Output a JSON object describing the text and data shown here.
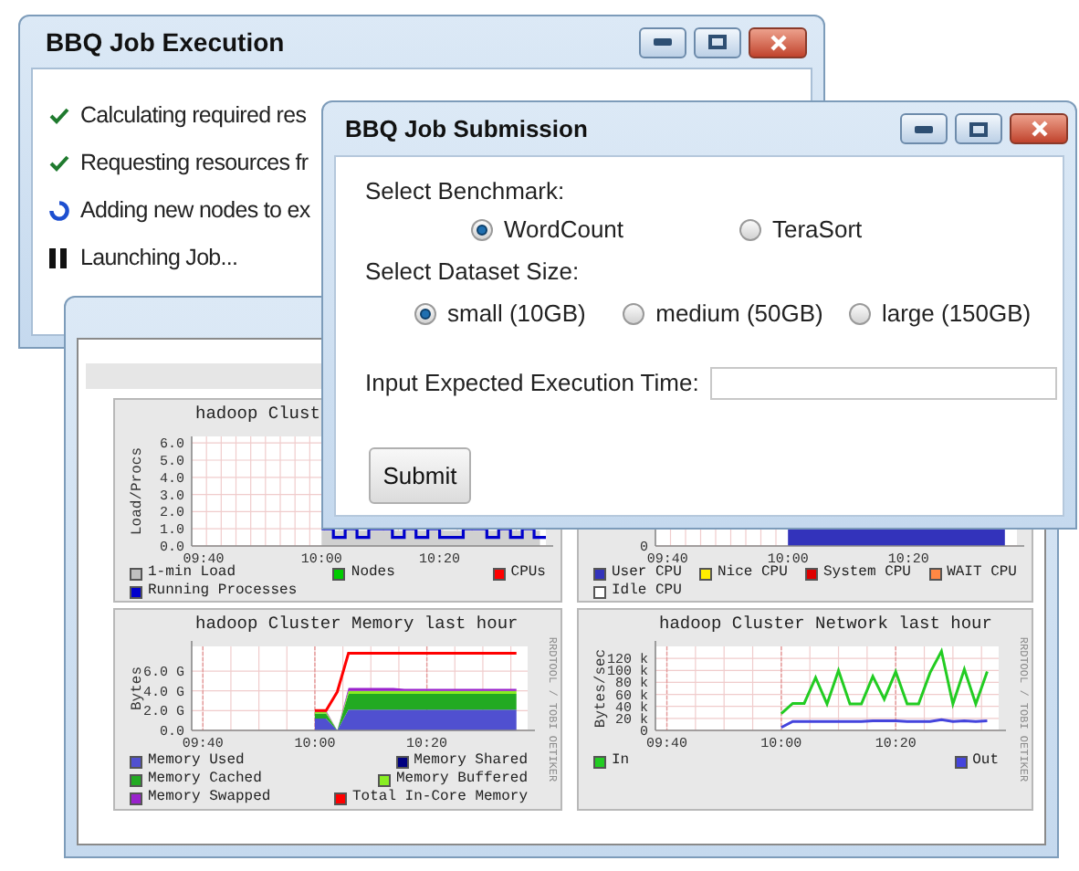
{
  "execution_window": {
    "title": "BBQ Job Execution",
    "steps": [
      {
        "kind": "done",
        "text": "Calculating required res"
      },
      {
        "kind": "done",
        "text": "Requesting resources fr"
      },
      {
        "kind": "running",
        "text": "Adding new nodes to ex"
      },
      {
        "kind": "paused",
        "text": "Launching Job..."
      }
    ]
  },
  "monitor_window": {
    "charts": [
      {
        "kind": "lines",
        "title": "hadoop Clust",
        "ylabel": "Load/Procs",
        "yticks": [
          "6.0",
          "5.0",
          "4.0",
          "3.0",
          "2.0",
          "1.0",
          "0.0"
        ],
        "xticks": [
          "09:40",
          "10:00",
          "10:20"
        ],
        "legend": [
          {
            "label": "1-min Load",
            "color": "#c0c0c0"
          },
          {
            "label": "Nodes",
            "color": "#00cc00"
          },
          {
            "label": "CPUs",
            "color": "#ff0000"
          },
          {
            "label": "Running Processes",
            "color": "#0000cc"
          }
        ]
      },
      {
        "kind": "fill",
        "yticks": [
          "0"
        ],
        "xticks": [
          "09:40",
          "10:00",
          "10:20"
        ],
        "legend": [
          {
            "label": "User CPU",
            "color": "#3333bb"
          },
          {
            "label": "Nice CPU",
            "color": "#ffee00"
          },
          {
            "label": "System CPU",
            "color": "#dd0000"
          },
          {
            "label": "WAIT CPU",
            "color": "#ff8844"
          },
          {
            "label": "Idle CPU",
            "color": "#ffffff"
          }
        ]
      },
      {
        "kind": "chart",
        "credit": "RRDTOOL / TOBI OETIKER",
        "chart_data": {
          "type": "area",
          "stacked": true,
          "grid": true,
          "title": "hadoop Cluster Memory last hour",
          "ylabel": "Bytes",
          "categories": [
            "09:40",
            null,
            null,
            null,
            null,
            null,
            null,
            null,
            null,
            null,
            "10:00",
            null,
            null,
            null,
            null,
            null,
            null,
            null,
            null,
            null,
            "10:20",
            null,
            null,
            null,
            null,
            null,
            null,
            null,
            null
          ],
          "ylim": [
            0,
            8.5
          ],
          "yticks": [
            {
              "value": 0,
              "label": "0.0"
            },
            {
              "value": 2,
              "label": "2.0 G"
            },
            {
              "value": 4,
              "label": "4.0 G"
            },
            {
              "value": 6,
              "label": "6.0 G"
            }
          ],
          "series": [
            {
              "name": "Memory Used",
              "color": "#5050d0",
              "values": [
                null,
                null,
                null,
                null,
                null,
                null,
                null,
                null,
                null,
                null,
                1.2,
                1.2,
                0,
                2.1,
                2.1,
                2.1,
                2.1,
                2.1,
                2.1,
                2.1,
                2.1,
                2.1,
                2.1,
                2.1,
                2.1,
                2.1,
                2.1,
                2.1,
                2.1
              ]
            },
            {
              "name": "Memory Shared",
              "color": "#000080",
              "values": [
                null,
                null,
                null,
                null,
                null,
                null,
                null,
                null,
                null,
                null,
                null,
                null,
                null,
                null,
                null,
                null,
                null,
                null,
                null,
                null,
                null,
                null,
                null,
                null,
                null,
                null,
                null,
                null,
                null
              ]
            },
            {
              "name": "Memory Cached",
              "color": "#22aa22",
              "values": [
                null,
                null,
                null,
                null,
                null,
                null,
                null,
                null,
                null,
                null,
                0.5,
                0.5,
                0,
                1.6,
                1.6,
                1.6,
                1.6,
                1.6,
                1.6,
                1.6,
                1.6,
                1.6,
                1.6,
                1.6,
                1.6,
                1.6,
                1.6,
                1.6,
                1.6
              ]
            },
            {
              "name": "Memory Buffered",
              "color": "#88ee22",
              "values": [
                null,
                null,
                null,
                null,
                null,
                null,
                null,
                null,
                null,
                null,
                0.2,
                0.2,
                0,
                0.3,
                0.3,
                0.3,
                0.3,
                0.3,
                0.3,
                0.3,
                0.3,
                0.3,
                0.3,
                0.3,
                0.3,
                0.3,
                0.3,
                0.3,
                0.3
              ]
            },
            {
              "name": "Memory Swapped",
              "color": "#9922cc",
              "values": [
                null,
                null,
                null,
                null,
                null,
                null,
                null,
                null,
                null,
                null,
                0.1,
                0.1,
                0,
                0.3,
                0.3,
                0.3,
                0.3,
                0.3,
                0.2,
                0.2,
                0.2,
                0.2,
                0.2,
                0.2,
                0.2,
                0.2,
                0.2,
                0.2,
                0.2
              ]
            },
            {
              "name": "Total In-Core Memory",
              "color": "#ff0000",
              "type": "line",
              "values": [
                null,
                null,
                null,
                null,
                null,
                null,
                null,
                null,
                null,
                null,
                2,
                2,
                3.9,
                7.8,
                7.8,
                7.8,
                7.8,
                7.8,
                7.8,
                7.8,
                7.8,
                7.8,
                7.8,
                7.8,
                7.8,
                7.8,
                7.8,
                7.8,
                7.8
              ]
            }
          ]
        }
      },
      {
        "kind": "chart",
        "credit": "RRDTOOL / TOBI OETIKER",
        "chart_data": {
          "type": "line",
          "grid": true,
          "title": "hadoop Cluster Network last hour",
          "ylabel": "Bytes/sec",
          "categories": [
            "09:40",
            null,
            null,
            null,
            null,
            null,
            null,
            null,
            null,
            null,
            "10:00",
            null,
            null,
            null,
            null,
            null,
            null,
            null,
            null,
            null,
            "10:20",
            null,
            null,
            null,
            null,
            null,
            null,
            null,
            null
          ],
          "ylim": [
            0,
            140
          ],
          "yticks": [
            {
              "value": 0,
              "label": "0"
            },
            {
              "value": 20,
              "label": "20 k"
            },
            {
              "value": 40,
              "label": "40 k"
            },
            {
              "value": 60,
              "label": "60 k"
            },
            {
              "value": 80,
              "label": "80 k"
            },
            {
              "value": 100,
              "label": "100 k"
            },
            {
              "value": 120,
              "label": "120 k"
            }
          ],
          "series": [
            {
              "name": "In",
              "color": "#22cc22",
              "values": [
                null,
                null,
                null,
                null,
                null,
                null,
                null,
                null,
                null,
                null,
                28,
                45,
                45,
                88,
                44,
                100,
                44,
                44,
                90,
                52,
                98,
                44,
                44,
                96,
                132,
                44,
                102,
                44,
                98
              ]
            },
            {
              "name": "Out",
              "color": "#4444dd",
              "values": [
                null,
                null,
                null,
                null,
                null,
                null,
                null,
                null,
                null,
                null,
                5,
                15,
                15,
                15,
                15,
                15,
                15,
                15,
                16,
                16,
                16,
                15,
                15,
                15,
                18,
                15,
                16,
                15,
                16
              ]
            }
          ]
        }
      }
    ]
  },
  "submission_window": {
    "title": "BBQ Job Submission",
    "benchmark": {
      "label": "Select Benchmark:",
      "options": [
        {
          "label": "WordCount",
          "selected": true
        },
        {
          "label": "TeraSort",
          "selected": false
        }
      ]
    },
    "dataset": {
      "label": "Select Dataset Size:",
      "options": [
        {
          "label": "small (10GB)",
          "selected": true
        },
        {
          "label": "medium (50GB)",
          "selected": false
        },
        {
          "label": "large (150GB)",
          "selected": false
        }
      ]
    },
    "time": {
      "label": "Input Expected Execution Time:"
    },
    "submit": "Submit"
  }
}
